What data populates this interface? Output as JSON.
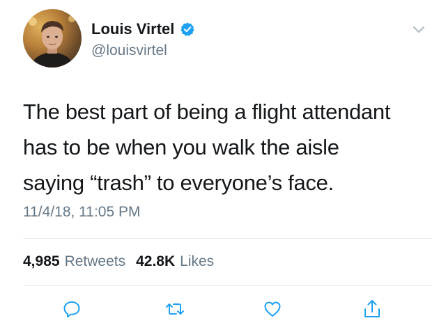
{
  "author": {
    "display_name": "Louis Virtel",
    "handle": "@louisvirtel",
    "verified": true,
    "avatar_icon": "profile-photo"
  },
  "tweet": {
    "lines": [
      "The best part of being a flight attendant",
      "has to be when you walk the aisle",
      "saying “trash” to everyone’s face."
    ],
    "timestamp": "11/4/18, 11:05 PM"
  },
  "stats": {
    "retweets_count": "4,985",
    "retweets_label": "Retweets",
    "likes_count": "42.8K",
    "likes_label": "Likes"
  },
  "actions": {
    "reply_icon": "reply-icon",
    "retweet_icon": "retweet-icon",
    "like_icon": "heart-icon",
    "share_icon": "share-icon"
  },
  "colors": {
    "text": "#14171a",
    "secondary": "#657786",
    "verified": "#1da1f2",
    "icon": "#1da1f2",
    "divider": "#e6ecf0"
  }
}
